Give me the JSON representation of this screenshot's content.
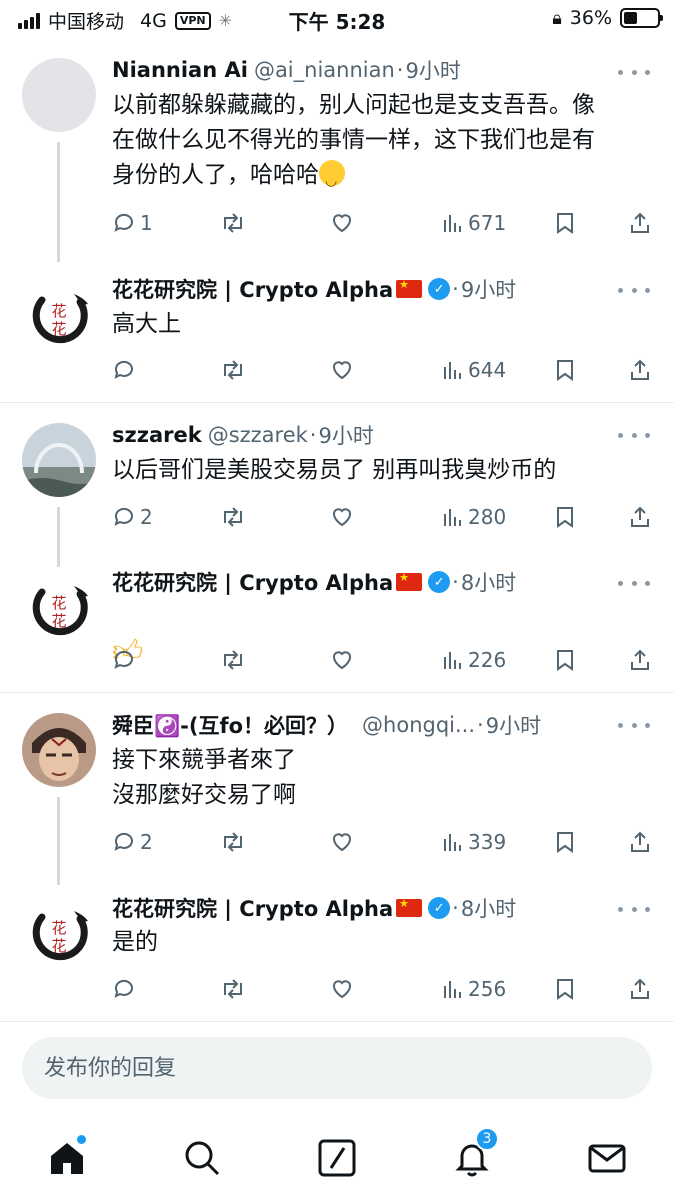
{
  "status_bar": {
    "carrier": "中国移动",
    "network": "4G",
    "vpn": "VPN",
    "time": "下午 5:28",
    "battery": "36%"
  },
  "tweets": [
    {
      "name": "Niannian Ai",
      "handle": "@ai_niannian",
      "time": "9小时",
      "text": "以前都躲躲藏藏的，别人问起也是支支吾吾。像\n在做什么见不得光的事情一样，这下我们也是有\n身份的人了，哈哈哈",
      "emoji": "grinning-squinting-face-emoji",
      "replies": "1",
      "retweets": "",
      "likes": "",
      "views": "671"
    },
    {
      "name": "花花研究院 | Crypto Alpha",
      "handle": "",
      "time": "9小时",
      "text": "高大上",
      "replies": "",
      "views": "644"
    },
    {
      "name": "szzarek",
      "handle": "@szzarek",
      "time": "9小时",
      "text": "以后哥们是美股交易员了 别再叫我臭炒币的",
      "replies": "2",
      "views": "280"
    },
    {
      "name": "花花研究院 | Crypto Alpha",
      "handle": "",
      "time": "8小时",
      "text": "",
      "emoji": "thumbs-up-emoji",
      "replies": "",
      "views": "226"
    },
    {
      "name": "舜臣☯️-(互fo！必回？）",
      "handle": "@hongqi...",
      "time": "9小时",
      "text": "接下來競爭者來了\n沒那麼好交易了啊",
      "replies": "2",
      "views": "339"
    },
    {
      "name": "花花研究院 | Crypto Alpha",
      "handle": "",
      "time": "8小时",
      "text": "是的",
      "replies": "",
      "views": "256"
    }
  ],
  "reply_box": {
    "placeholder": "发布你的回复"
  },
  "bottom_nav": {
    "items": [
      "home-icon",
      "search-icon",
      "grok-icon",
      "notifications-icon",
      "messages-icon"
    ],
    "notification_count": "3"
  },
  "colors": {
    "accent": "#1d9bf0",
    "secondary_text": "#536471",
    "divider": "#e6ecf0"
  }
}
